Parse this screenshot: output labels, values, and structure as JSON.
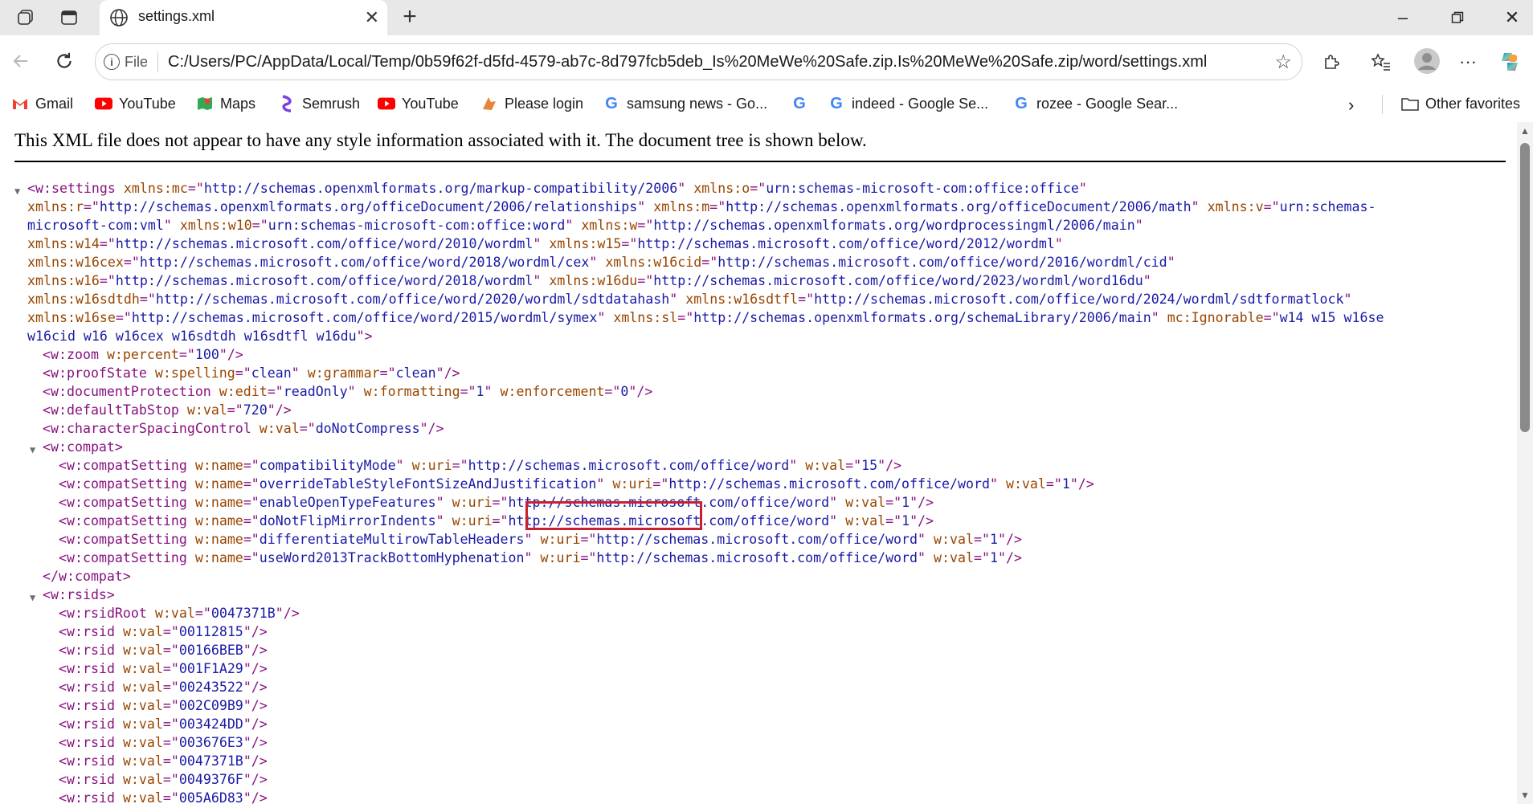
{
  "tab": {
    "title": "settings.xml"
  },
  "address": {
    "scheme_label": "File",
    "url": "C:/Users/PC/AppData/Local/Temp/0b59f62f-d5fd-4579-ab7c-8d797fcb5deb_Is%20MeWe%20Safe.zip.Is%20MeWe%20Safe.zip/word/settings.xml"
  },
  "bookmarks": [
    {
      "label": "Gmail",
      "icon": "gmail-icon"
    },
    {
      "label": "YouTube",
      "icon": "youtube-icon"
    },
    {
      "label": "Maps",
      "icon": "maps-icon"
    },
    {
      "label": "Semrush",
      "icon": "semrush-icon"
    },
    {
      "label": "YouTube",
      "icon": "youtube-icon"
    },
    {
      "label": "Please login",
      "icon": "login-icon"
    },
    {
      "label": "samsung news - Go...",
      "icon": "google-icon"
    },
    {
      "label": "",
      "icon": "google-icon"
    },
    {
      "label": "indeed - Google Se...",
      "icon": "google-icon"
    },
    {
      "label": "rozee - Google Sear...",
      "icon": "google-icon"
    }
  ],
  "other_favorites": "Other favorites",
  "notice": "This XML file does not appear to have any style information associated with it. The document tree is shown below.",
  "xml_lines": [
    {
      "tri": "down",
      "segs": [
        [
          "t",
          "<w:settings"
        ],
        [
          "p",
          " "
        ],
        [
          "a",
          "xmlns:mc"
        ],
        [
          "t",
          "=\""
        ],
        [
          "v",
          "http://schemas.openxmlformats.org/markup-compatibility/2006"
        ],
        [
          "t",
          "\""
        ],
        [
          "p",
          " "
        ],
        [
          "a",
          "xmlns:o"
        ],
        [
          "t",
          "=\""
        ],
        [
          "v",
          "urn:schemas-microsoft-com:office:office"
        ],
        [
          "t",
          "\""
        ]
      ]
    },
    {
      "segs": [
        [
          "a",
          "xmlns:r"
        ],
        [
          "t",
          "=\""
        ],
        [
          "v",
          "http://schemas.openxmlformats.org/officeDocument/2006/relationships"
        ],
        [
          "t",
          "\""
        ],
        [
          "p",
          " "
        ],
        [
          "a",
          "xmlns:m"
        ],
        [
          "t",
          "=\""
        ],
        [
          "v",
          "http://schemas.openxmlformats.org/officeDocument/2006/math"
        ],
        [
          "t",
          "\""
        ],
        [
          "p",
          " "
        ],
        [
          "a",
          "xmlns:v"
        ],
        [
          "t",
          "=\""
        ],
        [
          "v",
          "urn:schemas-"
        ]
      ]
    },
    {
      "segs": [
        [
          "v",
          "microsoft-com:vml"
        ],
        [
          "t",
          "\""
        ],
        [
          "p",
          " "
        ],
        [
          "a",
          "xmlns:w10"
        ],
        [
          "t",
          "=\""
        ],
        [
          "v",
          "urn:schemas-microsoft-com:office:word"
        ],
        [
          "t",
          "\""
        ],
        [
          "p",
          " "
        ],
        [
          "a",
          "xmlns:w"
        ],
        [
          "t",
          "=\""
        ],
        [
          "v",
          "http://schemas.openxmlformats.org/wordprocessingml/2006/main"
        ],
        [
          "t",
          "\""
        ]
      ]
    },
    {
      "segs": [
        [
          "a",
          "xmlns:w14"
        ],
        [
          "t",
          "=\""
        ],
        [
          "v",
          "http://schemas.microsoft.com/office/word/2010/wordml"
        ],
        [
          "t",
          "\""
        ],
        [
          "p",
          " "
        ],
        [
          "a",
          "xmlns:w15"
        ],
        [
          "t",
          "=\""
        ],
        [
          "v",
          "http://schemas.microsoft.com/office/word/2012/wordml"
        ],
        [
          "t",
          "\""
        ]
      ]
    },
    {
      "segs": [
        [
          "a",
          "xmlns:w16cex"
        ],
        [
          "t",
          "=\""
        ],
        [
          "v",
          "http://schemas.microsoft.com/office/word/2018/wordml/cex"
        ],
        [
          "t",
          "\""
        ],
        [
          "p",
          " "
        ],
        [
          "a",
          "xmlns:w16cid"
        ],
        [
          "t",
          "=\""
        ],
        [
          "v",
          "http://schemas.microsoft.com/office/word/2016/wordml/cid"
        ],
        [
          "t",
          "\""
        ]
      ]
    },
    {
      "segs": [
        [
          "a",
          "xmlns:w16"
        ],
        [
          "t",
          "=\""
        ],
        [
          "v",
          "http://schemas.microsoft.com/office/word/2018/wordml"
        ],
        [
          "t",
          "\""
        ],
        [
          "p",
          " "
        ],
        [
          "a",
          "xmlns:w16du"
        ],
        [
          "t",
          "=\""
        ],
        [
          "v",
          "http://schemas.microsoft.com/office/word/2023/wordml/word16du"
        ],
        [
          "t",
          "\""
        ]
      ]
    },
    {
      "segs": [
        [
          "a",
          "xmlns:w16sdtdh"
        ],
        [
          "t",
          "=\""
        ],
        [
          "v",
          "http://schemas.microsoft.com/office/word/2020/wordml/sdtdatahash"
        ],
        [
          "t",
          "\""
        ],
        [
          "p",
          " "
        ],
        [
          "a",
          "xmlns:w16sdtfl"
        ],
        [
          "t",
          "=\""
        ],
        [
          "v",
          "http://schemas.microsoft.com/office/word/2024/wordml/sdtformatlock"
        ],
        [
          "t",
          "\""
        ]
      ]
    },
    {
      "segs": [
        [
          "a",
          "xmlns:w16se"
        ],
        [
          "t",
          "=\""
        ],
        [
          "v",
          "http://schemas.microsoft.com/office/word/2015/wordml/symex"
        ],
        [
          "t",
          "\""
        ],
        [
          "p",
          " "
        ],
        [
          "a",
          "xmlns:sl"
        ],
        [
          "t",
          "=\""
        ],
        [
          "v",
          "http://schemas.openxmlformats.org/schemaLibrary/2006/main"
        ],
        [
          "t",
          "\""
        ],
        [
          "p",
          " "
        ],
        [
          "a",
          "mc:Ignorable"
        ],
        [
          "t",
          "=\""
        ],
        [
          "v",
          "w14 w15 w16se"
        ]
      ]
    },
    {
      "segs": [
        [
          "v",
          "w16cid w16 w16cex w16sdtdh w16sdtfl w16du"
        ],
        [
          "t",
          "\">"
        ]
      ]
    },
    {
      "segs": [
        [
          "t",
          "<w:zoom"
        ],
        [
          "p",
          " "
        ],
        [
          "a",
          "w:percent"
        ],
        [
          "t",
          "=\""
        ],
        [
          "v",
          "100"
        ],
        [
          "t",
          "\"/>"
        ]
      ]
    },
    {
      "segs": [
        [
          "t",
          "<w:proofState"
        ],
        [
          "p",
          " "
        ],
        [
          "a",
          "w:spelling"
        ],
        [
          "t",
          "=\""
        ],
        [
          "v",
          "clean"
        ],
        [
          "t",
          "\""
        ],
        [
          "p",
          " "
        ],
        [
          "a",
          "w:grammar"
        ],
        [
          "t",
          "=\""
        ],
        [
          "v",
          "clean"
        ],
        [
          "t",
          "\"/>"
        ]
      ]
    },
    {
      "segs": [
        [
          "t",
          "<w:documentProtection"
        ],
        [
          "p",
          " "
        ],
        [
          "a",
          "w:edit"
        ],
        [
          "t",
          "=\""
        ],
        [
          "v",
          "readOnly"
        ],
        [
          "t",
          "\""
        ],
        [
          "p",
          " "
        ],
        [
          "a",
          "w:formatting"
        ],
        [
          "t",
          "=\""
        ],
        [
          "v",
          "1"
        ],
        [
          "t",
          "\""
        ],
        [
          "p",
          " "
        ],
        [
          "a",
          "w:enforcement"
        ],
        [
          "t",
          "=\""
        ],
        [
          "v",
          "0"
        ],
        [
          "t",
          "\"/>"
        ]
      ]
    },
    {
      "segs": [
        [
          "t",
          "<w:defaultTabStop"
        ],
        [
          "p",
          " "
        ],
        [
          "a",
          "w:val"
        ],
        [
          "t",
          "=\""
        ],
        [
          "v",
          "720"
        ],
        [
          "t",
          "\"/>"
        ]
      ]
    },
    {
      "segs": [
        [
          "t",
          "<w:characterSpacingControl"
        ],
        [
          "p",
          " "
        ],
        [
          "a",
          "w:val"
        ],
        [
          "t",
          "=\""
        ],
        [
          "v",
          "doNotCompress"
        ],
        [
          "t",
          "\"/>"
        ]
      ]
    },
    {
      "tri": "down",
      "segs": [
        [
          "t",
          "<w:compat>"
        ]
      ]
    },
    {
      "segs": [
        [
          "t",
          "<w:compatSetting"
        ],
        [
          "p",
          " "
        ],
        [
          "a",
          "w:name"
        ],
        [
          "t",
          "=\""
        ],
        [
          "v",
          "compatibilityMode"
        ],
        [
          "t",
          "\""
        ],
        [
          "p",
          " "
        ],
        [
          "a",
          "w:uri"
        ],
        [
          "t",
          "=\""
        ],
        [
          "v",
          "http://schemas.microsoft.com/office/word"
        ],
        [
          "t",
          "\""
        ],
        [
          "p",
          " "
        ],
        [
          "a",
          "w:val"
        ],
        [
          "t",
          "=\""
        ],
        [
          "v",
          "15"
        ],
        [
          "t",
          "\"/>"
        ]
      ]
    },
    {
      "segs": [
        [
          "t",
          "<w:compatSetting"
        ],
        [
          "p",
          " "
        ],
        [
          "a",
          "w:name"
        ],
        [
          "t",
          "=\""
        ],
        [
          "v",
          "overrideTableStyleFontSizeAndJustification"
        ],
        [
          "t",
          "\""
        ],
        [
          "p",
          " "
        ],
        [
          "a",
          "w:uri"
        ],
        [
          "t",
          "=\""
        ],
        [
          "v",
          "http://schemas.microsoft.com/office/word"
        ],
        [
          "t",
          "\""
        ],
        [
          "p",
          " "
        ],
        [
          "a",
          "w:val"
        ],
        [
          "t",
          "=\""
        ],
        [
          "v",
          "1"
        ],
        [
          "t",
          "\"/>"
        ]
      ]
    },
    {
      "segs": [
        [
          "t",
          "<w:compatSetting"
        ],
        [
          "p",
          " "
        ],
        [
          "a",
          "w:name"
        ],
        [
          "t",
          "=\""
        ],
        [
          "v",
          "enableOpenTypeFeatures"
        ],
        [
          "t",
          "\""
        ],
        [
          "p",
          " "
        ],
        [
          "a",
          "w:uri"
        ],
        [
          "t",
          "=\""
        ],
        [
          "v",
          "http://schemas.microsoft.com/office/word"
        ],
        [
          "t",
          "\""
        ],
        [
          "p",
          " "
        ],
        [
          "a",
          "w:val"
        ],
        [
          "t",
          "=\""
        ],
        [
          "v",
          "1"
        ],
        [
          "t",
          "\"/>"
        ]
      ]
    },
    {
      "segs": [
        [
          "t",
          "<w:compatSetting"
        ],
        [
          "p",
          " "
        ],
        [
          "a",
          "w:name"
        ],
        [
          "t",
          "=\""
        ],
        [
          "v",
          "doNotFlipMirrorIndents"
        ],
        [
          "t",
          "\""
        ],
        [
          "p",
          " "
        ],
        [
          "a",
          "w:uri"
        ],
        [
          "t",
          "=\""
        ],
        [
          "v",
          "http://schemas.microsoft.com/office/word"
        ],
        [
          "t",
          "\""
        ],
        [
          "p",
          " "
        ],
        [
          "a",
          "w:val"
        ],
        [
          "t",
          "=\""
        ],
        [
          "v",
          "1"
        ],
        [
          "t",
          "\"/>"
        ]
      ]
    },
    {
      "segs": [
        [
          "t",
          "<w:compatSetting"
        ],
        [
          "p",
          " "
        ],
        [
          "a",
          "w:name"
        ],
        [
          "t",
          "=\""
        ],
        [
          "v",
          "differentiateMultirowTableHeaders"
        ],
        [
          "t",
          "\""
        ],
        [
          "p",
          " "
        ],
        [
          "a",
          "w:uri"
        ],
        [
          "t",
          "=\""
        ],
        [
          "v",
          "http://schemas.microsoft.com/office/word"
        ],
        [
          "t",
          "\""
        ],
        [
          "p",
          " "
        ],
        [
          "a",
          "w:val"
        ],
        [
          "t",
          "=\""
        ],
        [
          "v",
          "1"
        ],
        [
          "t",
          "\"/>"
        ]
      ]
    },
    {
      "segs": [
        [
          "t",
          "<w:compatSetting"
        ],
        [
          "p",
          " "
        ],
        [
          "a",
          "w:name"
        ],
        [
          "t",
          "=\""
        ],
        [
          "v",
          "useWord2013TrackBottomHyphenation"
        ],
        [
          "t",
          "\""
        ],
        [
          "p",
          " "
        ],
        [
          "a",
          "w:uri"
        ],
        [
          "t",
          "=\""
        ],
        [
          "v",
          "http://schemas.microsoft.com/office/word"
        ],
        [
          "t",
          "\""
        ],
        [
          "p",
          " "
        ],
        [
          "a",
          "w:val"
        ],
        [
          "t",
          "=\""
        ],
        [
          "v",
          "1"
        ],
        [
          "t",
          "\"/>"
        ]
      ]
    },
    {
      "segs": [
        [
          "t",
          "</w:compat>"
        ]
      ]
    },
    {
      "tri": "down",
      "segs": [
        [
          "t",
          "<w:rsids>"
        ]
      ]
    },
    {
      "segs": [
        [
          "t",
          "<w:rsidRoot"
        ],
        [
          "p",
          " "
        ],
        [
          "a",
          "w:val"
        ],
        [
          "t",
          "=\""
        ],
        [
          "v",
          "0047371B"
        ],
        [
          "t",
          "\"/>"
        ]
      ]
    },
    {
      "segs": [
        [
          "t",
          "<w:rsid"
        ],
        [
          "p",
          " "
        ],
        [
          "a",
          "w:val"
        ],
        [
          "t",
          "=\""
        ],
        [
          "v",
          "00112815"
        ],
        [
          "t",
          "\"/>"
        ]
      ]
    },
    {
      "segs": [
        [
          "t",
          "<w:rsid"
        ],
        [
          "p",
          " "
        ],
        [
          "a",
          "w:val"
        ],
        [
          "t",
          "=\""
        ],
        [
          "v",
          "00166BEB"
        ],
        [
          "t",
          "\"/>"
        ]
      ]
    },
    {
      "segs": [
        [
          "t",
          "<w:rsid"
        ],
        [
          "p",
          " "
        ],
        [
          "a",
          "w:val"
        ],
        [
          "t",
          "=\""
        ],
        [
          "v",
          "001F1A29"
        ],
        [
          "t",
          "\"/>"
        ]
      ]
    },
    {
      "segs": [
        [
          "t",
          "<w:rsid"
        ],
        [
          "p",
          " "
        ],
        [
          "a",
          "w:val"
        ],
        [
          "t",
          "=\""
        ],
        [
          "v",
          "00243522"
        ],
        [
          "t",
          "\"/>"
        ]
      ]
    },
    {
      "segs": [
        [
          "t",
          "<w:rsid"
        ],
        [
          "p",
          " "
        ],
        [
          "a",
          "w:val"
        ],
        [
          "t",
          "=\""
        ],
        [
          "v",
          "002C09B9"
        ],
        [
          "t",
          "\"/>"
        ]
      ]
    },
    {
      "segs": [
        [
          "t",
          "<w:rsid"
        ],
        [
          "p",
          " "
        ],
        [
          "a",
          "w:val"
        ],
        [
          "t",
          "=\""
        ],
        [
          "v",
          "003424DD"
        ],
        [
          "t",
          "\"/>"
        ]
      ]
    },
    {
      "segs": [
        [
          "t",
          "<w:rsid"
        ],
        [
          "p",
          " "
        ],
        [
          "a",
          "w:val"
        ],
        [
          "t",
          "=\""
        ],
        [
          "v",
          "003676E3"
        ],
        [
          "t",
          "\"/>"
        ]
      ]
    },
    {
      "segs": [
        [
          "t",
          "<w:rsid"
        ],
        [
          "p",
          " "
        ],
        [
          "a",
          "w:val"
        ],
        [
          "t",
          "=\""
        ],
        [
          "v",
          "0047371B"
        ],
        [
          "t",
          "\"/>"
        ]
      ]
    },
    {
      "segs": [
        [
          "t",
          "<w:rsid"
        ],
        [
          "p",
          " "
        ],
        [
          "a",
          "w:val"
        ],
        [
          "t",
          "=\""
        ],
        [
          "v",
          "0049376F"
        ],
        [
          "t",
          "\"/>"
        ]
      ]
    },
    {
      "segs": [
        [
          "t",
          "<w:rsid"
        ],
        [
          "p",
          " "
        ],
        [
          "a",
          "w:val"
        ],
        [
          "t",
          "=\""
        ],
        [
          "v",
          "005A6D83"
        ],
        [
          "t",
          "\"/>"
        ]
      ]
    }
  ],
  "colors": {
    "tag": "#881280",
    "attr_name": "#994500",
    "attr_value": "#1a1aa6",
    "highlight_box": "#c8202e"
  }
}
